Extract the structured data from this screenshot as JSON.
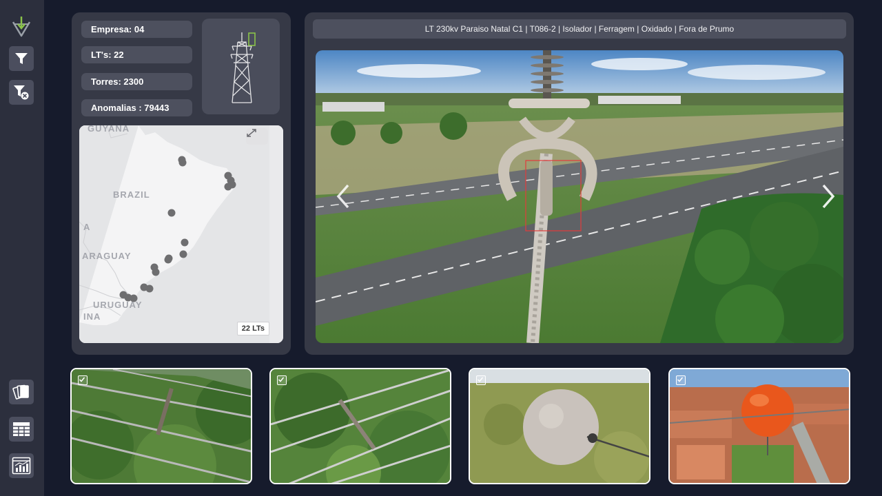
{
  "stats": {
    "empresa": "Empresa: 04",
    "lts": "LT's: 22",
    "torres": "Torres: 2300",
    "anomalias": "Anomalias : 79443"
  },
  "map": {
    "labels": [
      "GUYANA",
      "BRAZIL",
      "A",
      "ARAGUAY",
      "URUGUAY",
      "INA"
    ],
    "lt_count": "22 LTs"
  },
  "viewer": {
    "title": "LT 230kv Paraiso Natal C1 |  T086-2 | Isolador | Ferragem | Oxidado | Fora de Prumo"
  },
  "icons": {
    "rail_top": [
      "download-tower-icon",
      "filter-icon",
      "filter-clear-icon"
    ],
    "rail_bottom": [
      "cards-icon",
      "table-icon",
      "dashboard-icon"
    ]
  },
  "colors": {
    "background": "#161b2c",
    "panel": "#363946",
    "pill": "#4d505e",
    "accent_green": "#8bc34a",
    "marker": "#6e6e70"
  },
  "thumbnails": {
    "checked": [
      true,
      true,
      true,
      true
    ]
  }
}
